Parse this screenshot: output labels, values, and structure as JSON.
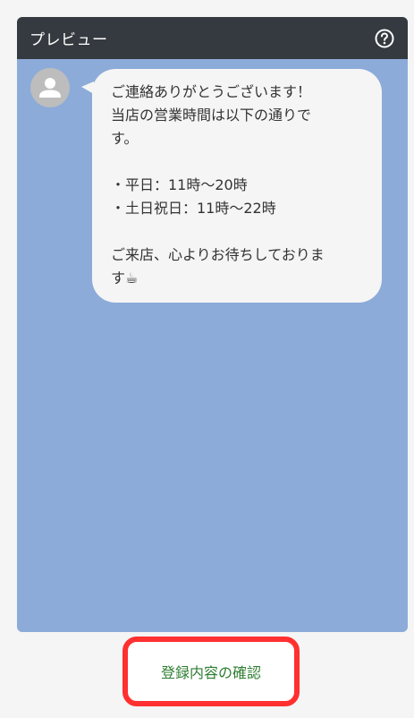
{
  "header": {
    "title": "プレビュー",
    "help_icon": "question-circle-icon"
  },
  "chat": {
    "avatar_icon": "person-icon",
    "message_lines": [
      "ご連絡ありがとうございます！",
      "当店の営業時間は以下の通りで",
      "す。",
      "",
      "・平日：11時〜20時",
      "・土日祝日：11時〜22時",
      "",
      "ご来店、心よりお待ちしておりま",
      "す☕"
    ]
  },
  "footer": {
    "confirm_label": "登録内容の確認"
  },
  "colors": {
    "header_bg": "#343a40",
    "chat_bg": "#8cabd9",
    "bubble_bg": "#f5f5f5",
    "button_text": "#2e7d32",
    "highlight_border": "#ff3030"
  }
}
